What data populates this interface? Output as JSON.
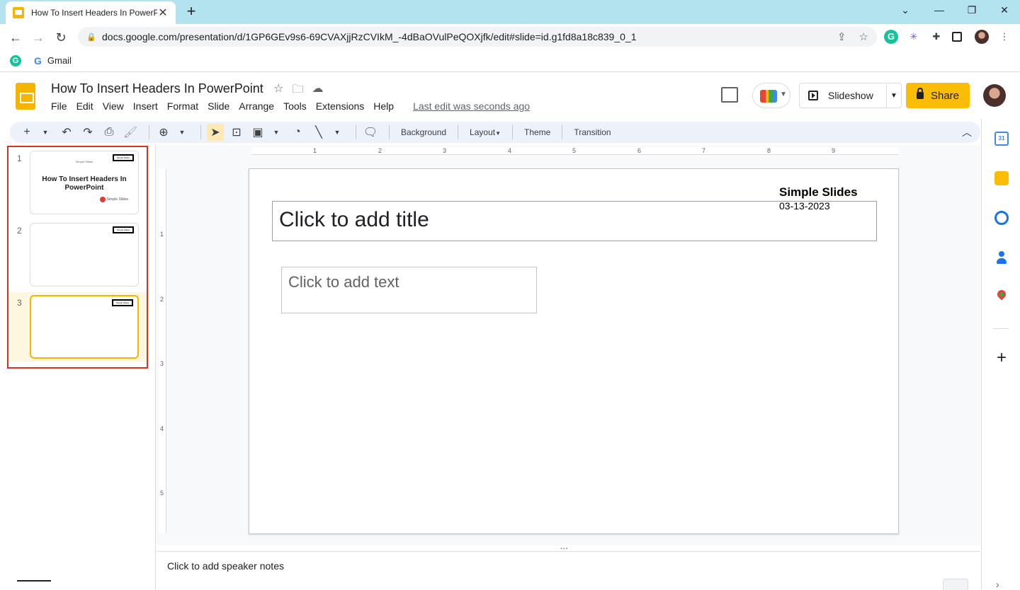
{
  "browser": {
    "tab_title": "How To Insert Headers In PowerPoint - Google Slides",
    "tab_close": "✕",
    "new_tab": "+",
    "url": "docs.google.com/presentation/d/1GP6GEv9s6-69CVAXjjRzCVIkM_-4dBaOVulPeQOXjfk/edit#slide=id.g1fd8a18c839_0_1",
    "bookmark_label": "Gmail"
  },
  "app": {
    "doc_title": "How To Insert Headers In PowerPoint",
    "menu": [
      "File",
      "Edit",
      "View",
      "Insert",
      "Format",
      "Slide",
      "Arrange",
      "Tools",
      "Extensions",
      "Help"
    ],
    "last_edit": "Last edit was seconds ago",
    "slideshow_label": "Slideshow",
    "share_label": "Share"
  },
  "toolbar": {
    "background_label": "Background",
    "layout_label": "Layout",
    "theme_label": "Theme",
    "transition_label": "Transition"
  },
  "filmstrip": {
    "slides": [
      {
        "number": "1",
        "title": "How To Insert Headers In PowerPoint",
        "logo_text": "Simple Slides",
        "tiny_text": "Simple Slides",
        "brand_text": "Simple Slides"
      },
      {
        "number": "2",
        "logo_text": "Simple Slides"
      },
      {
        "number": "3",
        "logo_text": "Simple Slides"
      }
    ],
    "active_slide": 3
  },
  "rulers": {
    "top": [
      "1",
      "2",
      "3",
      "4",
      "5",
      "6",
      "7",
      "8",
      "9"
    ],
    "left": [
      "1",
      "2",
      "3",
      "4",
      "5"
    ]
  },
  "slide": {
    "header_name": "Simple Slides",
    "header_date": "03-13-2023",
    "title_placeholder": "Click to add title",
    "body_placeholder": "Click to add text"
  },
  "notes": {
    "placeholder": "Click to add speaker notes"
  },
  "side_panel": {
    "calendar_day": "31"
  }
}
